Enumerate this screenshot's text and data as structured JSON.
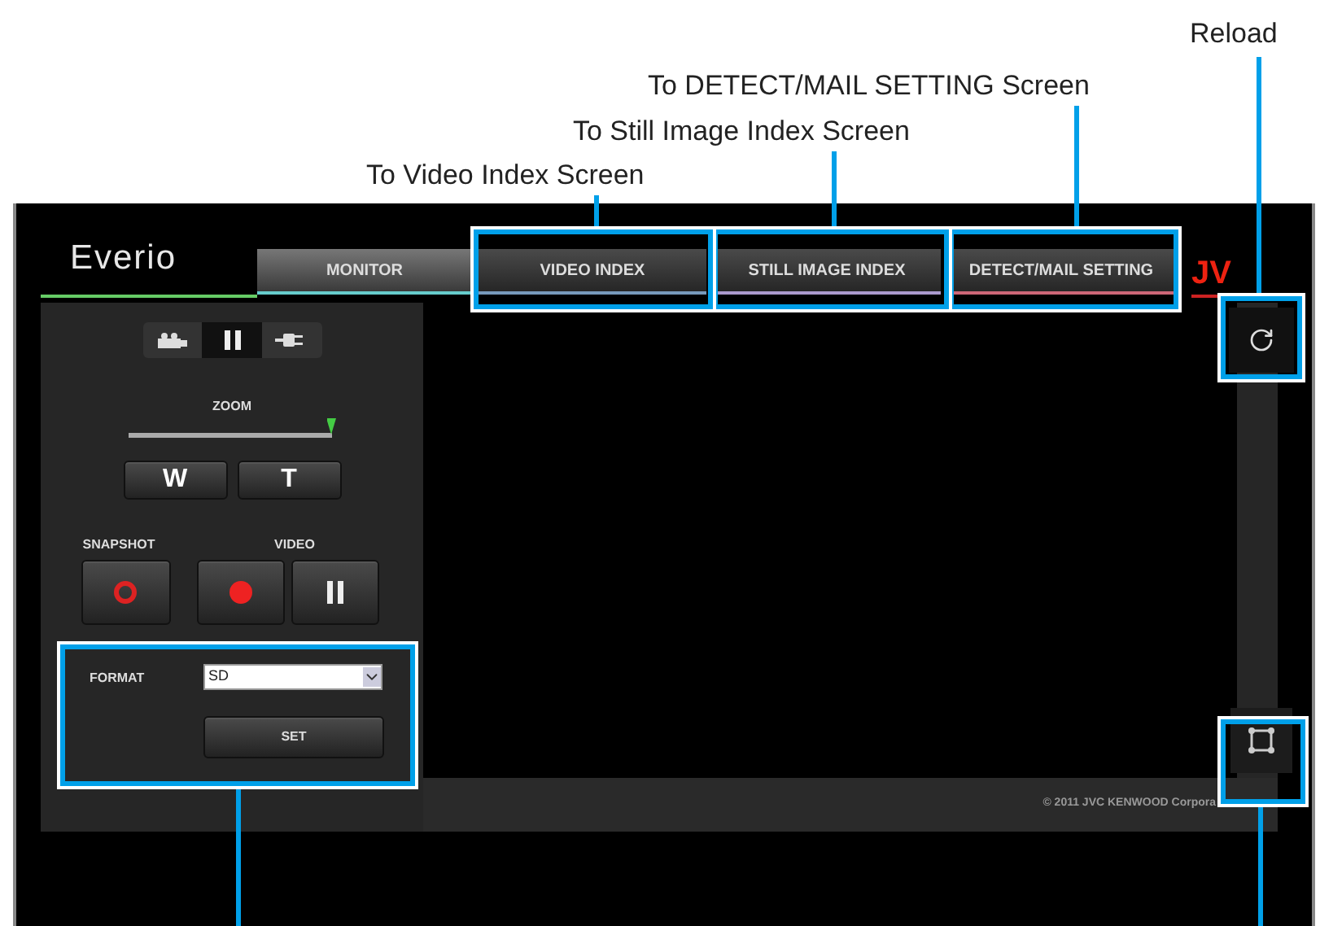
{
  "callouts": [
    {
      "label": "Reload"
    },
    {
      "label": "To DETECT/MAIL SETTING Screen"
    },
    {
      "label": "To Still Image Index Screen"
    },
    {
      "label": "To Video Index Screen"
    }
  ],
  "header": {
    "logo": "Everio",
    "brand": "JV",
    "tabs": [
      {
        "label": "MONITOR",
        "selected": true
      },
      {
        "label": "VIDEO INDEX",
        "selected": false
      },
      {
        "label": "STILL IMAGE INDEX",
        "selected": false
      },
      {
        "label": "DETECT/MAIL SETTING",
        "selected": false
      }
    ]
  },
  "mode_switch": [
    {
      "kind": "camera",
      "selected": false
    },
    {
      "kind": "pause",
      "selected": true
    },
    {
      "kind": "plug",
      "selected": false
    }
  ],
  "zoom": {
    "label": "ZOOM",
    "level": 1,
    "buttons": [
      "W",
      "T"
    ]
  },
  "snapshot": {
    "label": "SNAPSHOT"
  },
  "video": {
    "label": "VIDEO"
  },
  "format": {
    "label": "FORMAT",
    "value": "SD",
    "button": "SET"
  },
  "footer": {
    "copyright": "© 2011 JVC KENWOOD Corpora"
  }
}
